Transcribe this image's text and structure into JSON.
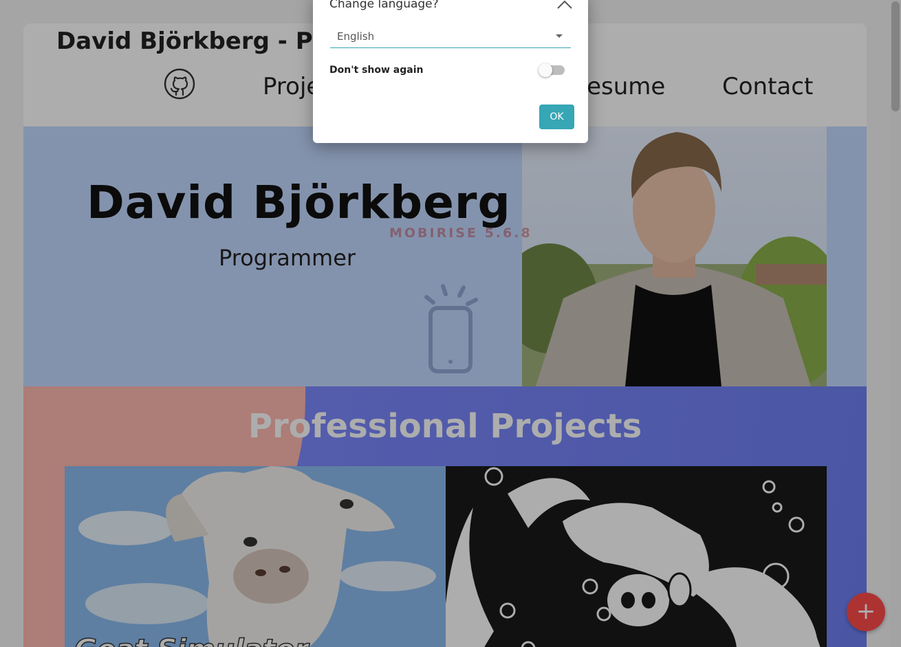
{
  "site": {
    "brand": "David Björkberg - Portf",
    "nav": {
      "github_icon": "github-icon",
      "projects_label": "Proje",
      "resume_label": "Resume",
      "contact_label": "Contact"
    },
    "hero": {
      "name": "David Björkberg",
      "role": "Programmer"
    },
    "projects": {
      "title": "Professional Projects"
    },
    "watermark": "MOBIRISE 5.6.8",
    "fab_label": "+"
  },
  "dialog": {
    "title": "Change language?",
    "close_icon": "chevron-up-icon",
    "language_value": "English",
    "toggle_label": "Don't show again",
    "toggle_on": false,
    "ok_label": "OK"
  },
  "colors": {
    "accent": "#37a6b5",
    "hero_bg": "#c3d9ff",
    "fab": "#ff4c4c"
  }
}
